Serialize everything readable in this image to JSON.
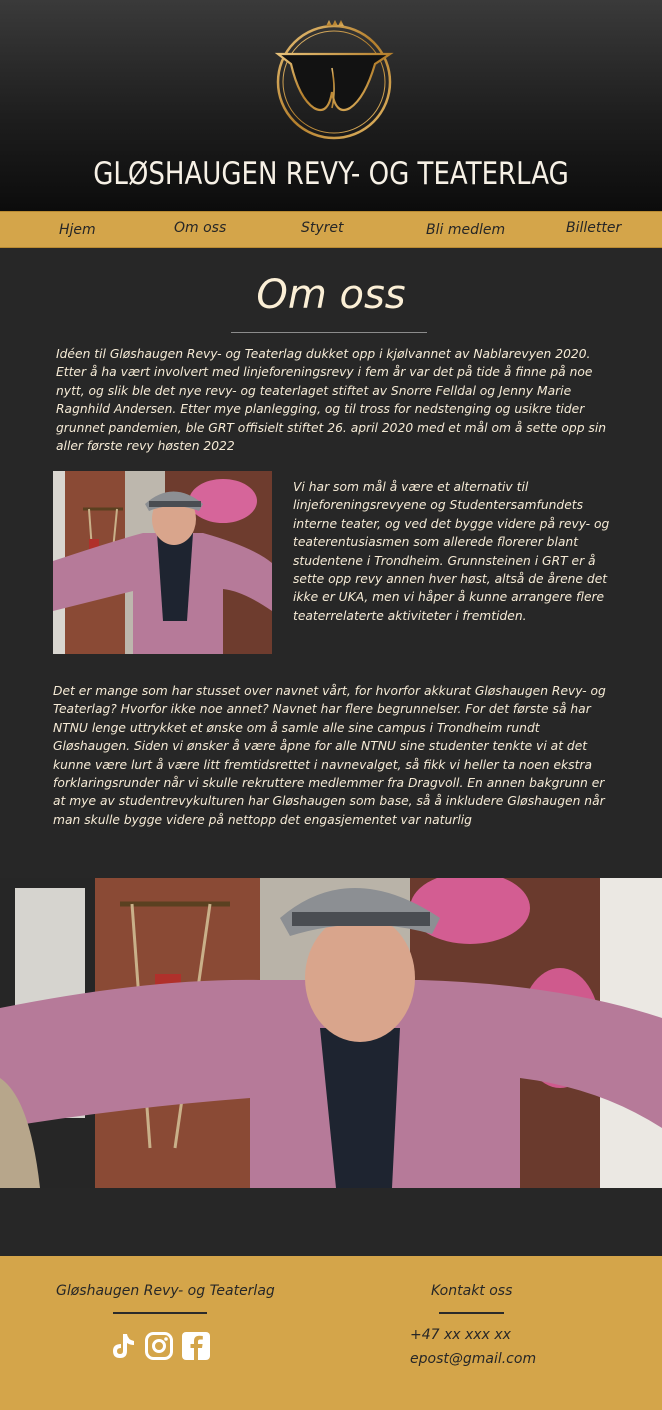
{
  "header": {
    "title": "GLØSHAUGEN REVY- OG TEATERLAG",
    "logo_icon": "crown-ring-logo-icon",
    "accent_color": "#c8963a"
  },
  "nav": {
    "items": [
      {
        "label": "Hjem"
      },
      {
        "label": "Om oss"
      },
      {
        "label": "Styret"
      },
      {
        "label": "Bli medlem"
      },
      {
        "label": "Billetter"
      }
    ],
    "background": "#d4a54a"
  },
  "main": {
    "heading": "Om oss",
    "paragraph1": "Idéen til Gløshaugen Revy- og Teaterlag dukket opp i kjølvannet av Nablarevyen 2020. Etter å ha vært involvert med linjeforeningsrevy i fem år var det på tide å finne på noe nytt, og slik ble det nye revy- og teaterlaget stiftet av Snorre Felldal og Jenny Marie Ragnhild Andersen. Etter mye planlegging, og til tross for nedstenging og usikre tider grunnet pandemien, ble GRT offisielt stiftet 26. april 2020 med et mål om å sette opp sin aller første revy høsten 2022",
    "paragraph2": "Vi har som mål å være et alternativ til linjeforeningsrevyene og Studentersamfundets interne teater, og ved det bygge videre på revy- og teaterentusiasmen som allerede florerer blant studentene i Trondheim. Grunnsteinen i GRT er å sette opp revy annen hver høst, altså de årene det ikke er UKA, men vi håper å kunne arrangere flere teaterrelaterte aktiviteter i fremtiden.",
    "paragraph3": "Det er mange som har stusset over navnet vårt, for hvorfor akkurat Gløshaugen Revy- og Teaterlag? Hvorfor ikke noe annet? Navnet har flere begrunnelser. For det første så har NTNU lenge uttrykket et ønske om å samle alle sine campus i Trondheim rundt Gløshaugen. Siden vi ønsker å være åpne for alle NTNU sine studenter tenkte vi at det kunne være lurt å være litt fremtidsrettet i navnevalget, så fikk vi heller ta noen ekstra forklaringsrunder når vi skulle rekruttere medlemmer fra Dragvoll. En annen bakgrunn er at mye av studentrevykulturen har Gløshaugen som base, så å inkludere Gløshaugen når man skulle bygge videre på nettopp det engasjementet var naturlig"
  },
  "footer": {
    "org_title": "Gløshaugen Revy- og Teaterlag",
    "contact_title": "Kontakt oss",
    "phone": "+47 xx xxx xx",
    "email": "epost@gmail.com",
    "social_icons": [
      "tiktok-icon",
      "instagram-icon",
      "facebook-icon"
    ]
  }
}
